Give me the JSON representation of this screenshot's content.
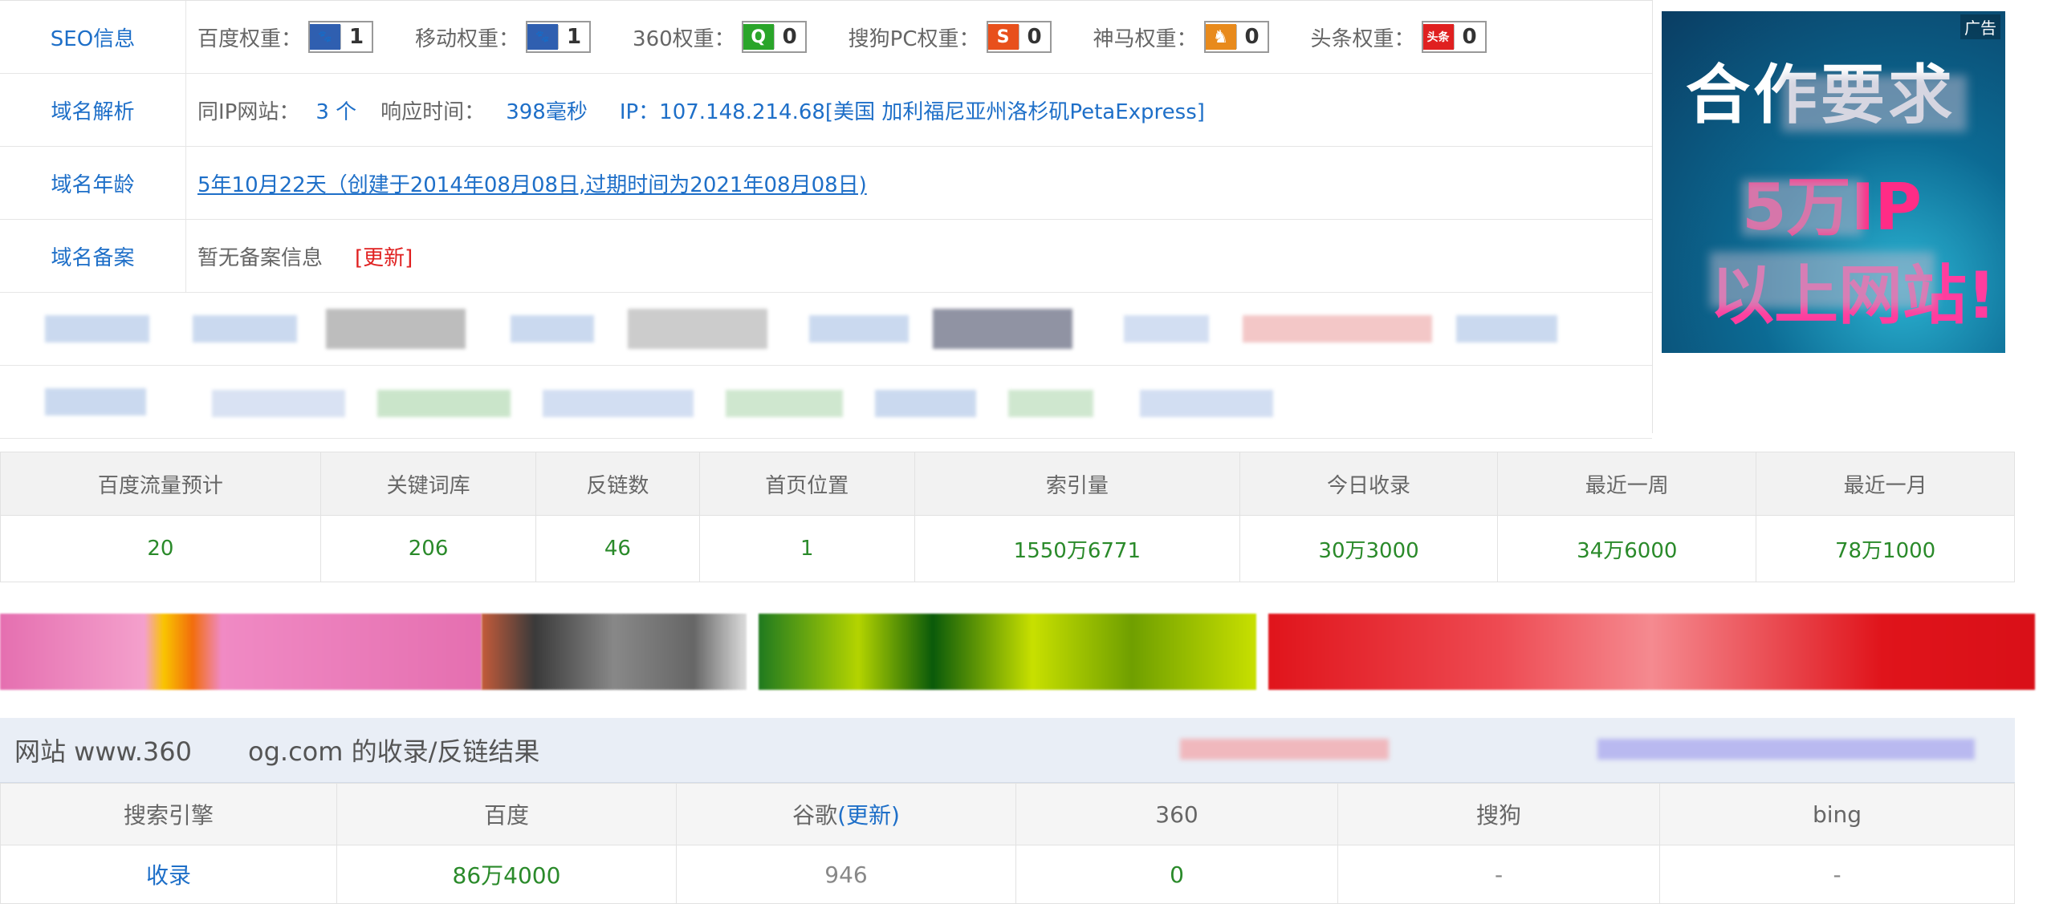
{
  "seo": {
    "label": "SEO信息",
    "weights": [
      {
        "name": "百度权重：",
        "icon": "baidu-paw-icon",
        "value": "1",
        "color": "#2f5fb0",
        "glyph": "🐾"
      },
      {
        "name": "移动权重：",
        "icon": "baidu-paw-icon",
        "value": "1",
        "color": "#2f5fb0",
        "glyph": "🐾"
      },
      {
        "name": "360权重：",
        "icon": "360-icon",
        "value": "0",
        "color": "#2aa52a",
        "glyph": "Q"
      },
      {
        "name": "搜狗PC权重：",
        "icon": "sogou-icon",
        "value": "0",
        "color": "#e8501c",
        "glyph": "S"
      },
      {
        "name": "神马权重：",
        "icon": "shenma-icon",
        "value": "0",
        "color": "#e88a1c",
        "glyph": "♞"
      },
      {
        "name": "头条权重：",
        "icon": "toutiao-icon",
        "value": "0",
        "color": "#e02020",
        "glyph": "头条"
      }
    ]
  },
  "dns": {
    "label": "域名解析",
    "same_ip_label": "同IP网站：",
    "same_ip_value": "3 个",
    "response_label": "响应时间：",
    "response_value": "398毫秒",
    "ip_text": "IP：107.148.214.68[美国 加利福尼亚州洛杉矶PetaExpress]"
  },
  "age": {
    "label": "域名年龄",
    "value": "5年10月22天（创建于2014年08月08日,过期时间为2021年08月08日)"
  },
  "icp": {
    "label": "域名备案",
    "value": "暂无备案信息",
    "update": "[更新]"
  },
  "ad": {
    "tag": "广告",
    "line1": "合作要求",
    "line2": "5万IP",
    "line3": "以上网站!"
  },
  "stats": {
    "headers": [
      "百度流量预计",
      "关键词库",
      "反链数",
      "首页位置",
      "索引量",
      "今日收录",
      "最近一周",
      "最近一月"
    ],
    "values": [
      "20",
      "206",
      "46",
      "1",
      "1550万6771",
      "30万3000",
      "34万6000",
      "78万1000"
    ]
  },
  "result": {
    "title": "网站 www.360",
    "title_tail": "og.com 的收录/反链结果",
    "headers": [
      "搜索引擎",
      "百度",
      "谷歌",
      "360",
      "搜狗",
      "bing"
    ],
    "google_update": "(更新)",
    "row_label": "收录",
    "row_values": [
      "86万4000",
      "946",
      "0",
      "-",
      "-"
    ]
  }
}
